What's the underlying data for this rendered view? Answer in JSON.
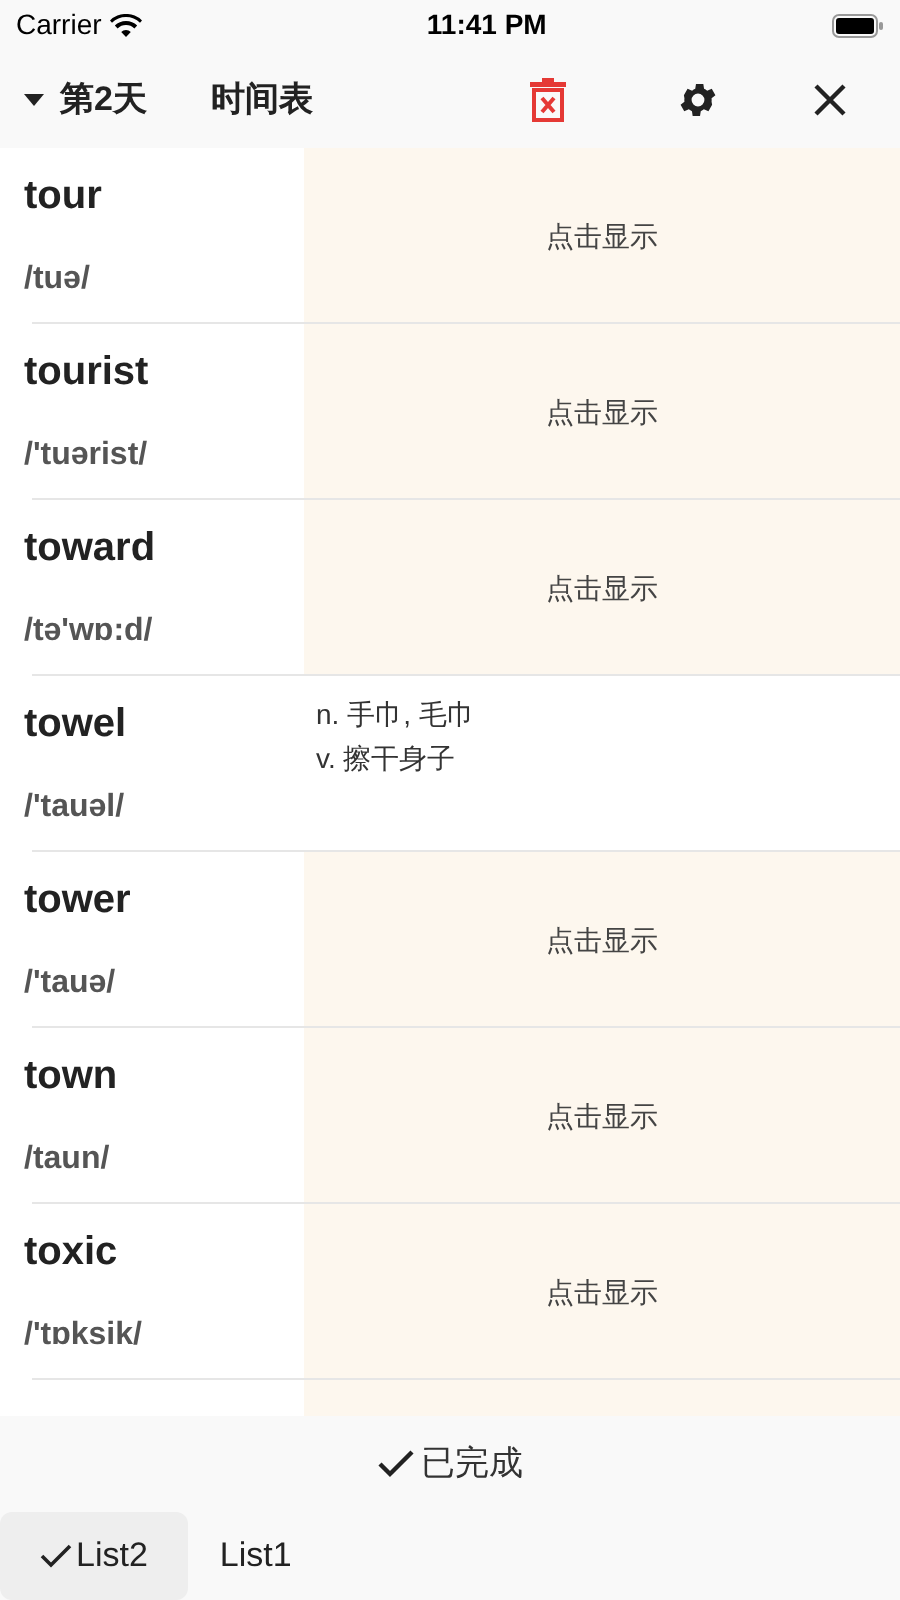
{
  "status_bar": {
    "carrier": "Carrier",
    "time": "11:41 PM"
  },
  "header": {
    "day": "第2天",
    "title": "时间表"
  },
  "words": [
    {
      "word": "tour",
      "phonetic": "/tuə/",
      "revealed": false,
      "prompt": "点击显示"
    },
    {
      "word": "tourist",
      "phonetic": "/'tuərist/",
      "revealed": false,
      "prompt": "点击显示"
    },
    {
      "word": "toward",
      "phonetic": "/tə'wɒ:d/",
      "revealed": false,
      "prompt": "点击显示"
    },
    {
      "word": "towel",
      "phonetic": "/'tauəl/",
      "revealed": true,
      "definition": [
        "n. 手巾, 毛巾",
        "v. 擦干身子"
      ]
    },
    {
      "word": "tower",
      "phonetic": "/'tauə/",
      "revealed": false,
      "prompt": "点击显示"
    },
    {
      "word": "town",
      "phonetic": "/taun/",
      "revealed": false,
      "prompt": "点击显示"
    },
    {
      "word": "toxic",
      "phonetic": "/'tɒksik/",
      "revealed": false,
      "prompt": "点击显示"
    }
  ],
  "done_button": "已完成",
  "tabs": [
    {
      "label": "List2",
      "selected": true
    },
    {
      "label": "List1",
      "selected": false
    }
  ]
}
